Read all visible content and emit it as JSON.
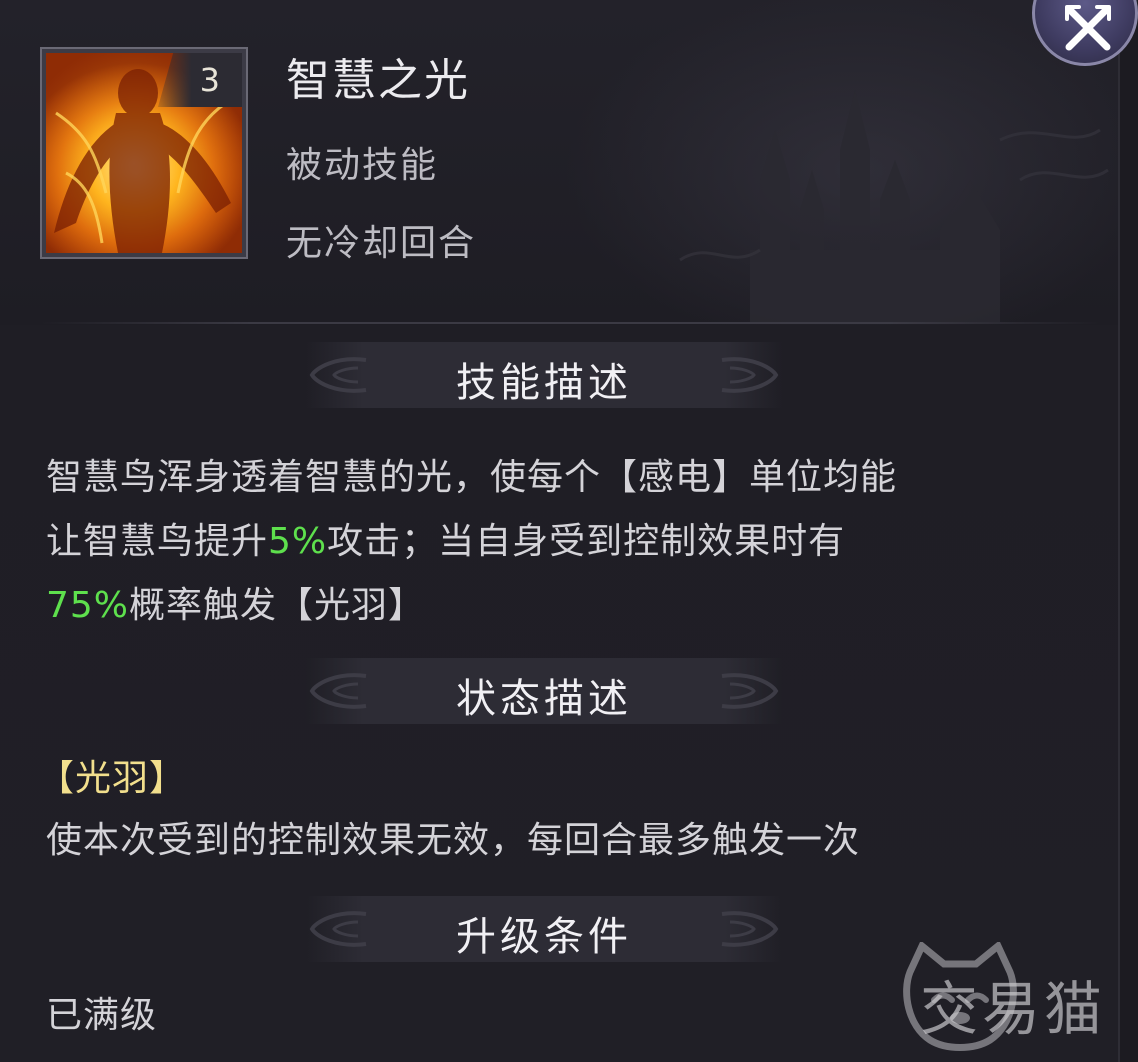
{
  "skill": {
    "name": "智慧之光",
    "type": "被动技能",
    "cooldown": "无冷却回合",
    "level": "3"
  },
  "sections": {
    "description_title": "技能描述",
    "status_title": "状态描述",
    "upgrade_title": "升级条件"
  },
  "description": {
    "p1": "智慧鸟浑身透着智慧的光，使每个【感电】单位均能",
    "p2a": "让智慧鸟提升",
    "p2_value": "5%",
    "p2b": "攻击；当自身受到控制效果时有",
    "p3_value": "75%",
    "p3b": "概率触发【光羽】"
  },
  "status": {
    "name": "【光羽】",
    "text": "使本次受到的控制效果无效，每回合最多触发一次"
  },
  "upgrade": {
    "text": "已满级"
  },
  "watermark": {
    "text": "交易猫"
  },
  "colors": {
    "highlight_green": "#5ee04d",
    "status_yellow": "#f2df8d",
    "panel_bg": "#201f26"
  },
  "icons": {
    "close": "close-x-icon",
    "skill": "flame-phoenix-icon"
  }
}
